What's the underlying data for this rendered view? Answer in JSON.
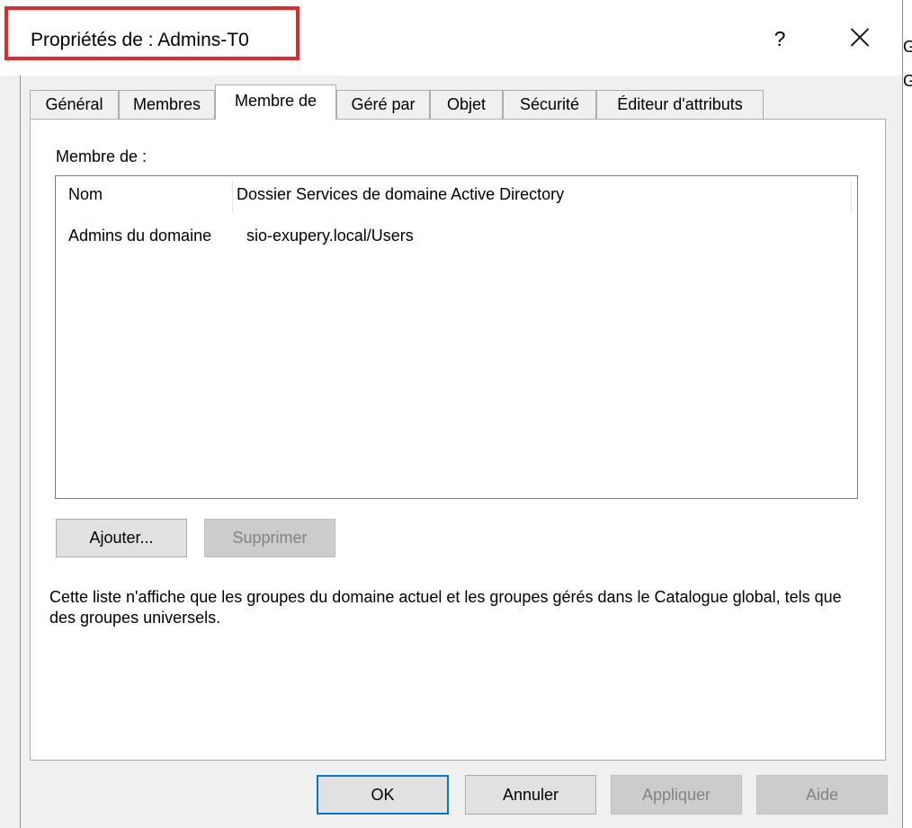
{
  "window": {
    "title": "Propriétés de : Admins-T0",
    "help_label": "?",
    "background_peek": [
      "G",
      "G"
    ]
  },
  "tabs": [
    {
      "label": "Général",
      "active": false
    },
    {
      "label": "Membres",
      "active": false
    },
    {
      "label": "Membre de",
      "active": true
    },
    {
      "label": "Géré par",
      "active": false
    },
    {
      "label": "Objet",
      "active": false
    },
    {
      "label": "Sécurité",
      "active": false
    },
    {
      "label": "Éditeur d'attributs",
      "active": false
    }
  ],
  "panel": {
    "member_of_label": "Membre de :",
    "list": {
      "columns": [
        "Nom",
        "Dossier Services de domaine Active Directory"
      ],
      "rows": [
        [
          "Admins du domaine",
          "sio-exupery.local/Users"
        ]
      ]
    },
    "add_button": "Ajouter...",
    "remove_button": "Supprimer",
    "info_text": "Cette liste n'affiche que les groupes du domaine actuel et les groupes gérés dans le Catalogue global, tels que des groupes universels."
  },
  "footer": {
    "ok": "OK",
    "cancel": "Annuler",
    "apply": "Appliquer",
    "help": "Aide"
  },
  "colors": {
    "title_highlight": "#e8262b",
    "default_button_border": "#0078d7",
    "dialog_background": "#f0f0f0"
  }
}
